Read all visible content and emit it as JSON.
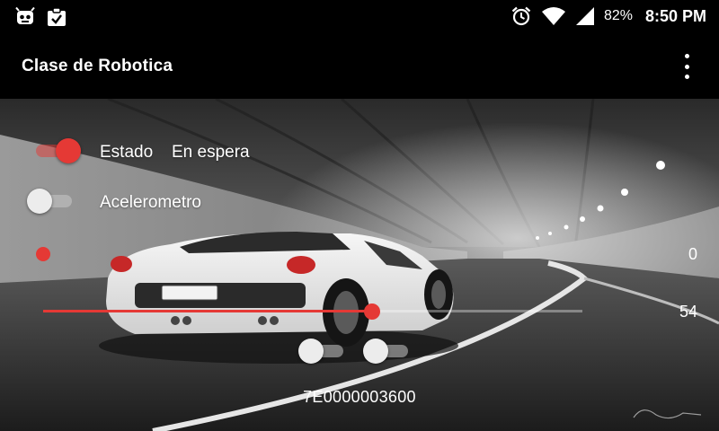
{
  "status_bar": {
    "icons_left": [
      "android-debug-icon",
      "clipboard-check-icon"
    ],
    "icons_right": [
      "alarm-icon",
      "wifi-icon",
      "signal-icon"
    ],
    "battery": "82%",
    "time": "8:50 PM"
  },
  "toolbar": {
    "title": "Clase de Robotica",
    "overflow_icon": "more-vert-icon"
  },
  "controls": {
    "estado": {
      "label": "Estado",
      "value": "En espera",
      "switch_on": true
    },
    "acelerometro": {
      "label": "Acelerometro",
      "switch_on": false
    },
    "indicator_value": "0",
    "seek_value": "54",
    "seek_fraction": 0.61,
    "small_switches": [
      false,
      false
    ],
    "device_id": "7E0000003600"
  },
  "colors": {
    "accent": "#e53935",
    "bar_background": "#000000",
    "text": "#ffffff"
  }
}
